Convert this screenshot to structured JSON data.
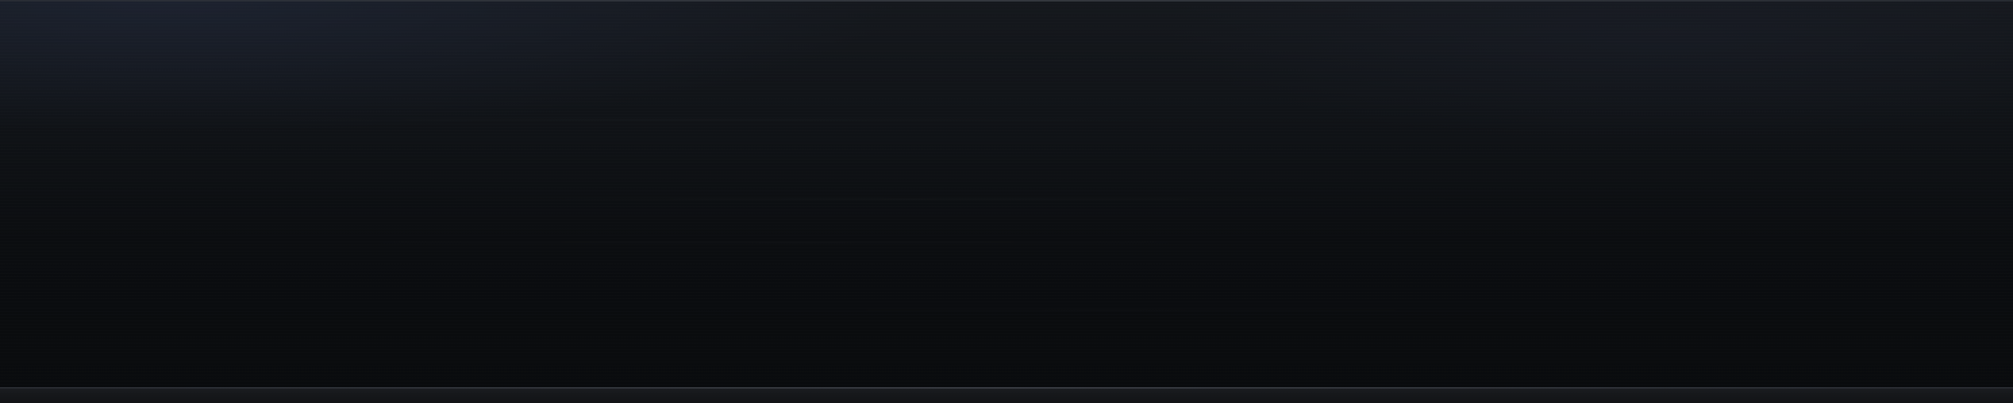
{
  "screen": {
    "background_colors": [
      "#15181d",
      "#0b0d10",
      "#090b0d"
    ],
    "accent_glow_color": "#222a3e",
    "bottom_rail_color": "#16181b"
  }
}
